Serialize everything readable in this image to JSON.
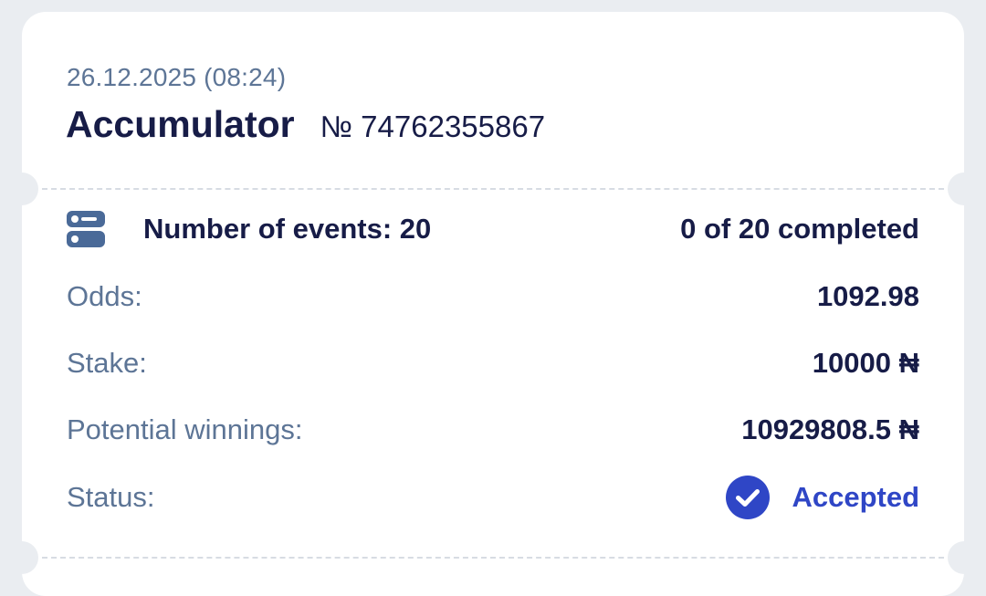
{
  "ticket": {
    "date": "26.12.2025 (08:24)",
    "bet_type": "Accumulator",
    "bet_number": "№ 74762355867",
    "events_icon": "toggle-list-icon",
    "events_label": "Number of events: 20",
    "events_completed": "0 of 20 completed",
    "odds_label": "Odds:",
    "odds_value": "1092.98",
    "stake_label": "Stake:",
    "stake_value": "10000 ₦",
    "winnings_label": "Potential winnings:",
    "winnings_value": "10929808.5 ₦",
    "status_label": "Status:",
    "status_icon": "check-circle-icon",
    "status_value": "Accepted"
  },
  "colors": {
    "background": "#eaedf1",
    "card": "#ffffff",
    "primary_text": "#171c47",
    "secondary_text": "#5d7596",
    "accent": "#2f46c6",
    "icon": "#4a6a98"
  }
}
